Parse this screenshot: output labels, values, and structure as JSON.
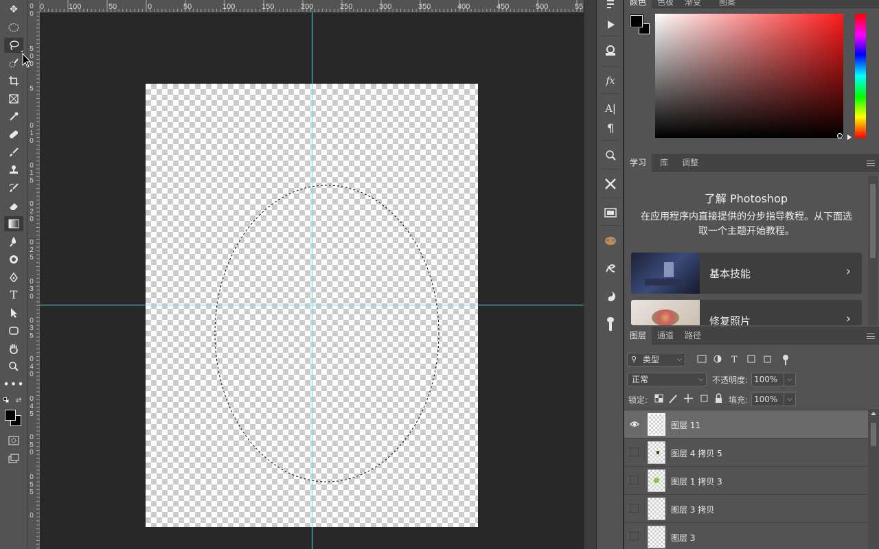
{
  "rulers": {
    "horizontal": [
      "0",
      "100",
      "50",
      "0",
      "50",
      "100",
      "150",
      "200",
      "250",
      "300",
      "350",
      "400",
      "450",
      "500",
      "55"
    ],
    "vertical": [
      "0",
      "0",
      "5",
      "0",
      "0",
      "5",
      "0",
      "1",
      "0",
      "0",
      "1",
      "5",
      "0",
      "2",
      "0",
      "0",
      "2",
      "5",
      "0",
      "3",
      "0",
      "0",
      "3",
      "5",
      "0",
      "4",
      "0",
      "0",
      "4",
      "5",
      "0",
      "5",
      "0",
      "0",
      "5",
      "5",
      "0"
    ]
  },
  "color_panel": {
    "tabs": [
      "颜色",
      "色板",
      "渐变",
      "图案"
    ],
    "foreground": "#000000",
    "background": "#ffffff",
    "hue_color": "#ff1a1a"
  },
  "learn_panel": {
    "tabs": [
      "学习",
      "库",
      "调整"
    ],
    "title": "了解 Photoshop",
    "description": "在应用程序内直接提供的分步指导教程。从下面选取一个主题开始教程。",
    "cards": [
      {
        "label": "基本技能",
        "arrow": "›"
      },
      {
        "label": "修复照片",
        "arrow": "›"
      }
    ]
  },
  "layers_panel": {
    "tabs": [
      "图层",
      "通道",
      "路径"
    ],
    "filter_kind": "类型",
    "blend_mode": "正常",
    "opacity_label": "不透明度:",
    "opacity_value": "100%",
    "lock_label": "锁定:",
    "fill_label": "填充:",
    "fill_value": "100%",
    "layers": [
      {
        "name": "图层 11",
        "visible": true,
        "selected": true
      },
      {
        "name": "图层 4 拷贝 5",
        "visible": false,
        "selected": false
      },
      {
        "name": "图层 1 拷贝 3",
        "visible": false,
        "selected": false
      },
      {
        "name": "图层 3 拷贝",
        "visible": false,
        "selected": false
      },
      {
        "name": "图层 3",
        "visible": false,
        "selected": false
      }
    ]
  },
  "colors": {
    "guide": "#5fe0e6",
    "panel_bg": "#535353"
  }
}
